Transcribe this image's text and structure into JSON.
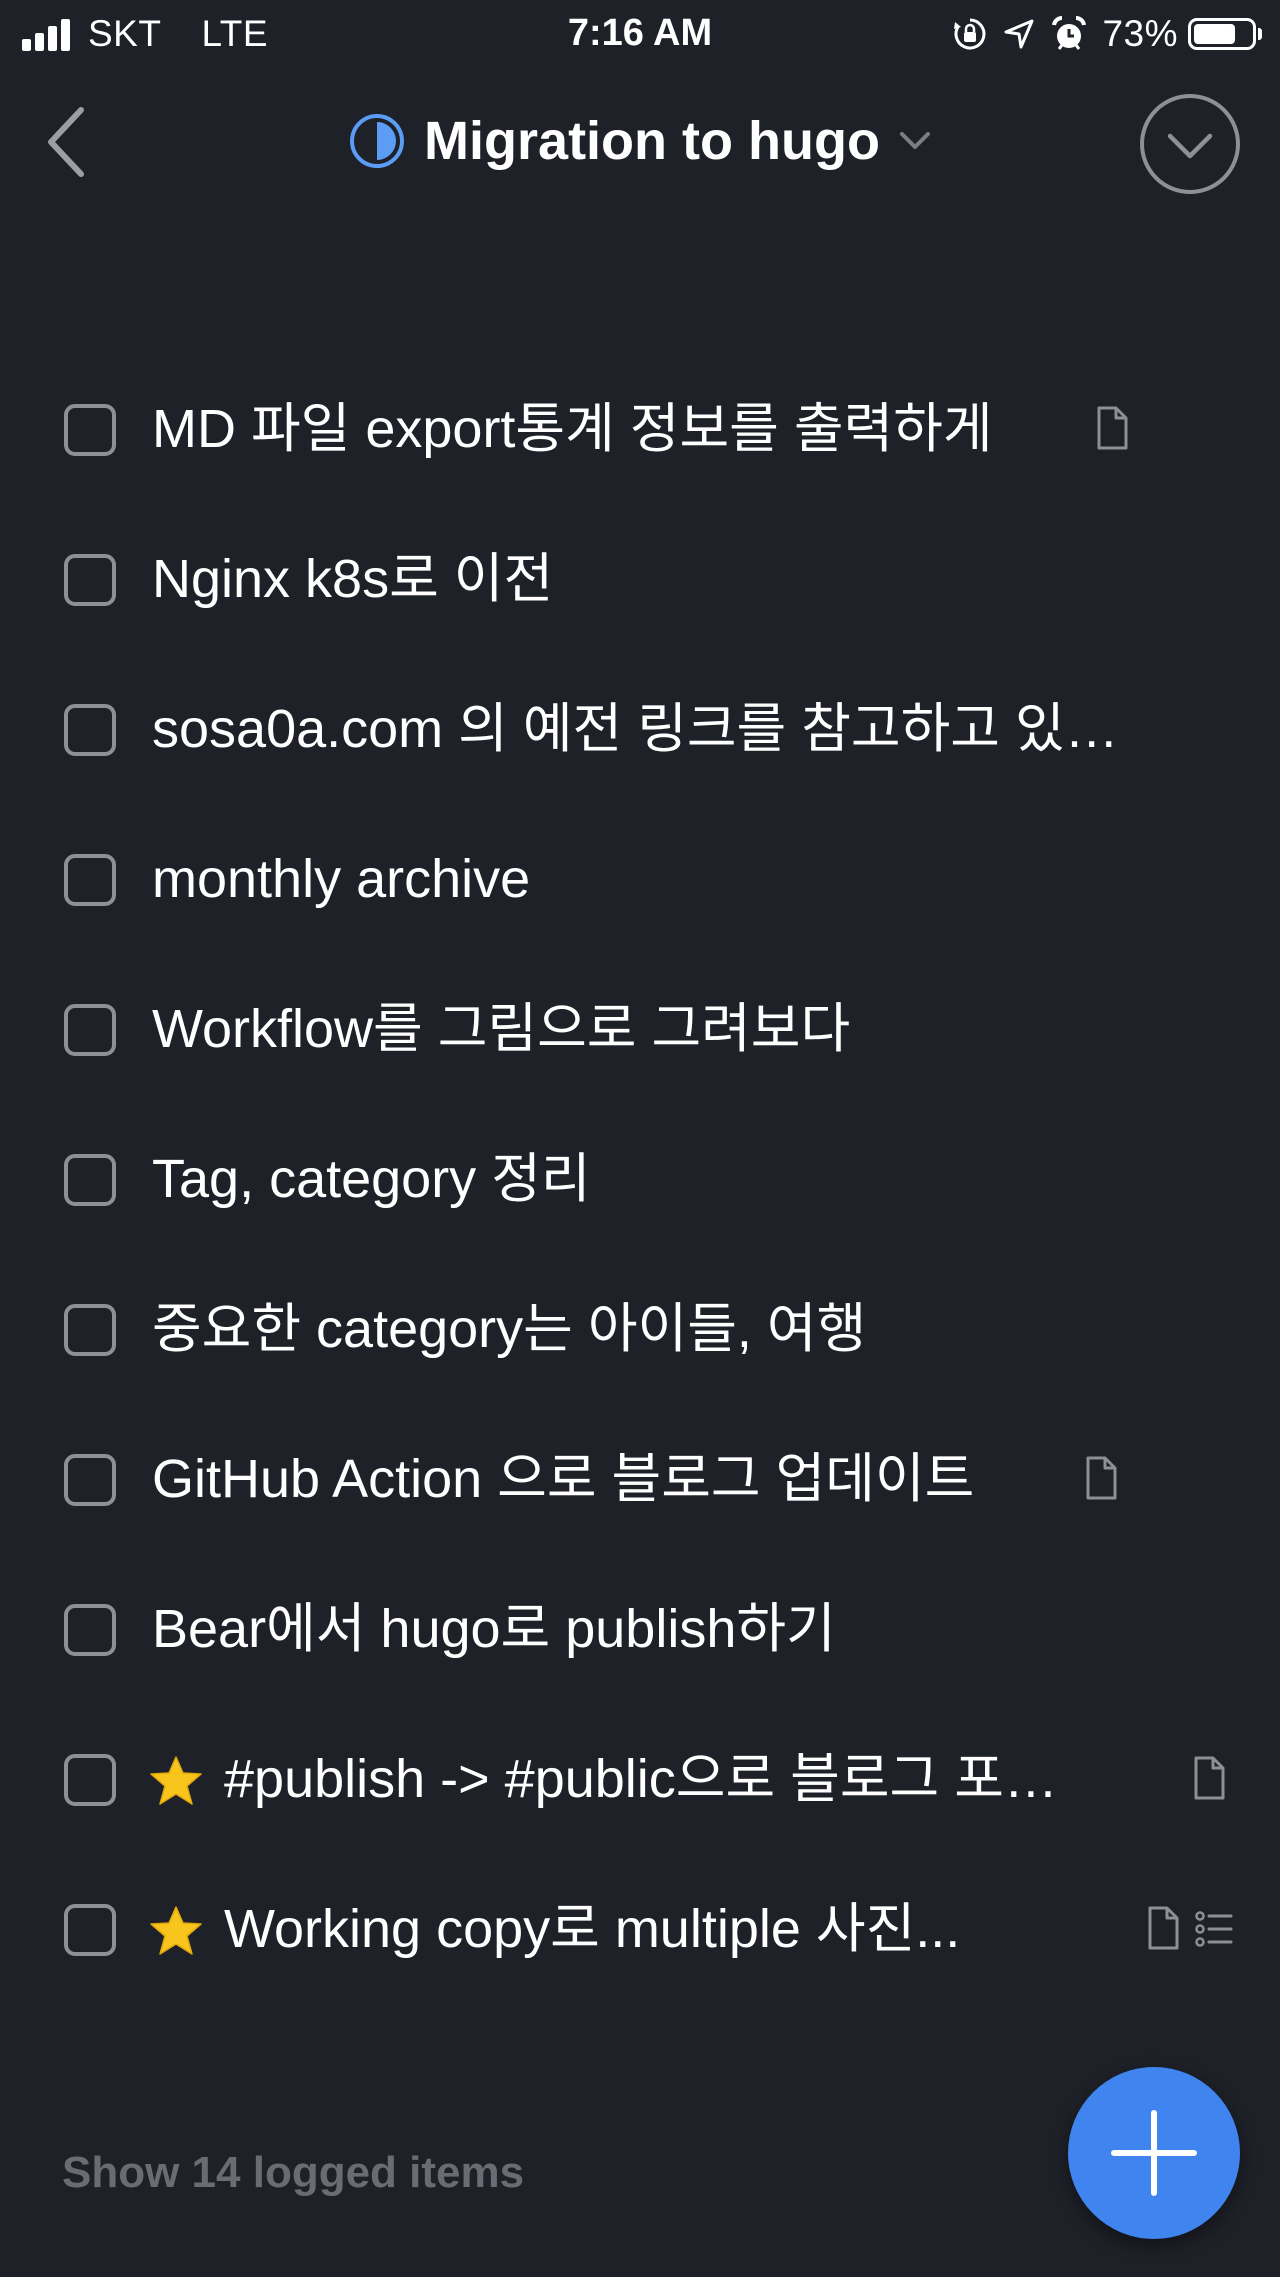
{
  "status_bar": {
    "carrier": "SKT",
    "network": "LTE",
    "time": "7:16 AM",
    "battery_percent": "73%",
    "battery_level": 0.73,
    "icons": [
      "signal-bars-icon",
      "orientation-lock-icon",
      "location-arrow-icon",
      "alarm-icon",
      "battery-icon"
    ]
  },
  "nav": {
    "back_icon": "chevron-left-icon",
    "project_icon": "half-filled-circle-icon",
    "title": "Migration to hugo",
    "title_dropdown_icon": "chevron-down-icon",
    "complete_icon": "circle-check-icon"
  },
  "tasks": [
    {
      "title": "MD 파일 export통계 정보를 출력하게",
      "starred": false,
      "has_note": true,
      "has_checklist": false
    },
    {
      "title": "Nginx k8s로 이전",
      "starred": false,
      "has_note": false,
      "has_checklist": false
    },
    {
      "title": "sosa0a.com 의 예전 링크를 참고하고 있…",
      "starred": false,
      "has_note": false,
      "has_checklist": false
    },
    {
      "title": "monthly archive",
      "starred": false,
      "has_note": false,
      "has_checklist": false
    },
    {
      "title": "Workflow를 그림으로 그려보다",
      "starred": false,
      "has_note": false,
      "has_checklist": false
    },
    {
      "title": "Tag, category 정리",
      "starred": false,
      "has_note": false,
      "has_checklist": false
    },
    {
      "title": "중요한 category는 아이들, 여행",
      "starred": false,
      "has_note": false,
      "has_checklist": false
    },
    {
      "title": "GitHub Action 으로 블로그 업데이트",
      "starred": false,
      "has_note": true,
      "has_checklist": false
    },
    {
      "title": "Bear에서 hugo로 publish하기",
      "starred": false,
      "has_note": false,
      "has_checklist": false
    },
    {
      "title": "#publish -> #public으로 블로그 포…",
      "starred": true,
      "has_note": true,
      "has_checklist": false
    },
    {
      "title": "Working copy로 multiple 사진...",
      "starred": true,
      "has_note": true,
      "has_checklist": true
    }
  ],
  "footer": {
    "logged_label": "Show 14 logged items",
    "add_button_icon": "plus-icon"
  },
  "colors": {
    "background": "#1f2129",
    "accent": "#3f84ef",
    "checkbox_border": "#8e9096",
    "muted_text": "#696c73",
    "star": "#f7c51e"
  }
}
